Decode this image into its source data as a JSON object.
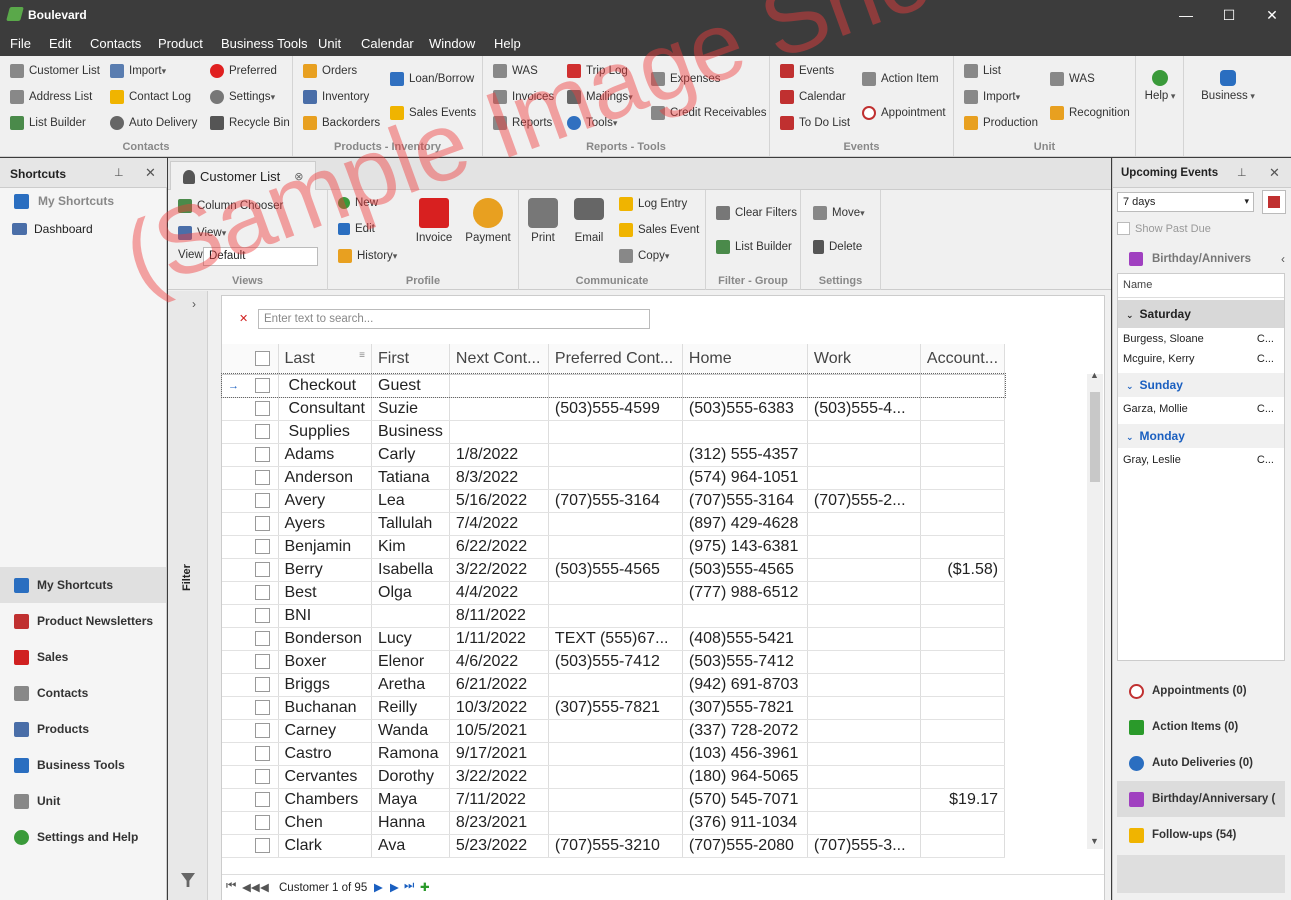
{
  "app": {
    "title": "Boulevard"
  },
  "menu": [
    "File",
    "Edit",
    "Contacts",
    "Product",
    "Business Tools",
    "Unit",
    "Calendar",
    "Window",
    "Help"
  ],
  "ribbon": {
    "contacts": {
      "label": "Contacts",
      "items": [
        "Customer List",
        "Address List",
        "List Builder",
        "Import",
        "Contact Log",
        "Auto Delivery",
        "Preferred",
        "Settings",
        "Recycle Bin"
      ]
    },
    "products": {
      "label": "Products - Inventory",
      "items": [
        "Orders",
        "Inventory",
        "Backorders",
        "Loan/Borrow",
        "Sales Events"
      ]
    },
    "reports": {
      "label": "Reports - Tools",
      "items": [
        "WAS",
        "Invoices",
        "Reports",
        "Trip Log",
        "Mailings",
        "Tools",
        "Expenses",
        "Credit Receivables"
      ]
    },
    "events": {
      "label": "Events",
      "items": [
        "Events",
        "Calendar",
        "To Do List",
        "Action Item",
        "Appointment"
      ]
    },
    "unit": {
      "label": "Unit",
      "items": [
        "List",
        "Import",
        "Production",
        "WAS",
        "Recognition"
      ]
    },
    "help": {
      "label": "Help"
    },
    "business": {
      "label": "Business"
    }
  },
  "left": {
    "header": "Shortcuts",
    "my_shortcuts": "My Shortcuts",
    "dashboard": "Dashboard",
    "nav": [
      "My Shortcuts",
      "Product Newsletters",
      "Sales",
      "Contacts",
      "Products",
      "Business Tools",
      "Unit",
      "Settings and Help"
    ]
  },
  "tab": {
    "label": "Customer List"
  },
  "subribbon": {
    "views": {
      "label": "Views",
      "column_chooser": "Column Chooser",
      "view": "View",
      "view_label": "View",
      "view_value": "Default"
    },
    "profile": {
      "label": "Profile",
      "new": "New",
      "edit": "Edit",
      "history": "History",
      "invoice": "Invoice",
      "payment": "Payment"
    },
    "communicate": {
      "label": "Communicate",
      "print": "Print",
      "email": "Email",
      "log_entry": "Log Entry",
      "sales_event": "Sales Event",
      "copy": "Copy"
    },
    "filter": {
      "label": "Filter - Group",
      "clear_filters": "Clear Filters",
      "list_builder": "List Builder"
    },
    "settings": {
      "label": "Settings",
      "move": "Move",
      "delete": "Delete"
    }
  },
  "filter_label": "Filter",
  "search": {
    "placeholder": "Enter text to search..."
  },
  "grid": {
    "columns": [
      "Last",
      "First",
      "Next Cont...",
      "Preferred Cont...",
      "Home",
      "Work",
      "Account..."
    ],
    "rows": [
      [
        "Checkout",
        "Guest",
        "",
        "",
        "",
        "",
        ""
      ],
      [
        "Consultant",
        "Suzie",
        "",
        "(503)555-4599",
        "(503)555-6383",
        "(503)555-4...",
        ""
      ],
      [
        "Supplies",
        "Business",
        "",
        "",
        "",
        "",
        ""
      ],
      [
        "Adams",
        "Carly",
        "1/8/2022",
        "",
        "(312) 555-4357",
        "",
        ""
      ],
      [
        "Anderson",
        "Tatiana",
        "8/3/2022",
        "",
        "(574) 964-1051",
        "",
        ""
      ],
      [
        "Avery",
        "Lea",
        "5/16/2022",
        "(707)555-3164",
        "(707)555-3164",
        "(707)555-2...",
        ""
      ],
      [
        "Ayers",
        "Tallulah",
        "7/4/2022",
        "",
        "(897) 429-4628",
        "",
        ""
      ],
      [
        "Benjamin",
        "Kim",
        "6/22/2022",
        "",
        "(975) 143-6381",
        "",
        ""
      ],
      [
        "Berry",
        "Isabella",
        "3/22/2022",
        "(503)555-4565",
        "(503)555-4565",
        "",
        "($1.58)"
      ],
      [
        "Best",
        "Olga",
        "4/4/2022",
        "",
        "(777) 988-6512",
        "",
        ""
      ],
      [
        "BNI",
        "",
        "8/11/2022",
        "",
        "",
        "",
        ""
      ],
      [
        "Bonderson",
        "Lucy",
        "1/11/2022",
        "TEXT (555)67...",
        "(408)555-5421",
        "",
        ""
      ],
      [
        "Boxer",
        "Elenor",
        "4/6/2022",
        "(503)555-7412",
        "(503)555-7412",
        "",
        ""
      ],
      [
        "Briggs",
        "Aretha",
        "6/21/2022",
        "",
        "(942) 691-8703",
        "",
        ""
      ],
      [
        "Buchanan",
        "Reilly",
        "10/3/2022",
        "(307)555-7821",
        "(307)555-7821",
        "",
        ""
      ],
      [
        "Carney",
        "Wanda",
        "10/5/2021",
        "",
        "(337) 728-2072",
        "",
        ""
      ],
      [
        "Castro",
        "Ramona",
        "9/17/2021",
        "",
        "(103) 456-3961",
        "",
        ""
      ],
      [
        "Cervantes",
        "Dorothy",
        "3/22/2022",
        "",
        "(180) 964-5065",
        "",
        ""
      ],
      [
        "Chambers",
        "Maya",
        "7/11/2022",
        "",
        "(570) 545-7071",
        "",
        "$19.17"
      ],
      [
        "Chen",
        "Hanna",
        "8/23/2021",
        "",
        "(376) 911-1034",
        "",
        ""
      ],
      [
        "Clark",
        "Ava",
        "5/23/2022",
        "(707)555-3210",
        "(707)555-2080",
        "(707)555-3...",
        ""
      ]
    ],
    "footer": "Customer 1 of 95"
  },
  "right": {
    "header": "Upcoming Events",
    "range": "7 days",
    "show_past_due": "Show Past Due",
    "birthday_tab": "Birthday/Annivers",
    "name_col": "Name",
    "groups": [
      {
        "day": "Saturday",
        "people": [
          "Burgess, Sloane",
          "Mcguire, Kerry"
        ]
      },
      {
        "day": "Sunday",
        "people": [
          "Garza, Mollie"
        ]
      },
      {
        "day": "Monday",
        "people": [
          "Gray, Leslie"
        ]
      }
    ],
    "sections": [
      "Appointments (0)",
      "Action Items (0)",
      "Auto Deliveries (0)",
      "Birthday/Anniversary (",
      "Follow-ups (54)"
    ]
  },
  "watermark": "(Sample Image Shown)"
}
